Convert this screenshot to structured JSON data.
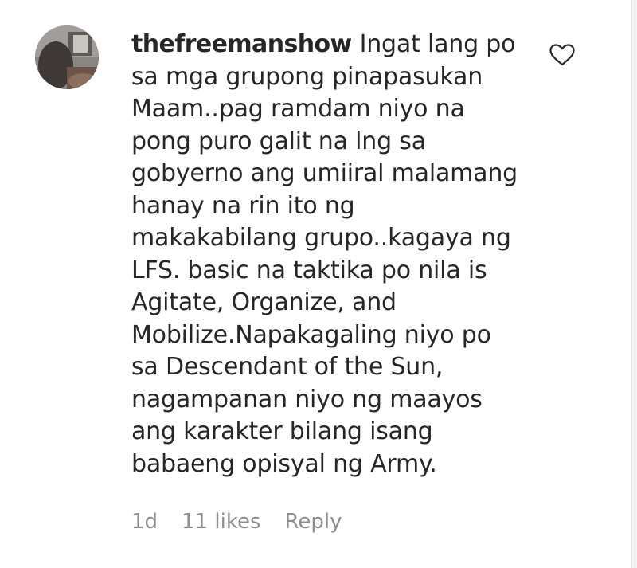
{
  "comment": {
    "username": "thefreemanshow",
    "lines": [
      "Ingat lang po",
      "sa mga grupong pinapasukan",
      "Maam..pag ramdam niyo na",
      "pong puro galit na lng sa",
      "gobyerno ang umiiral malamang",
      "hanay na rin ito ng",
      "makakabilang grupo..kagaya ng",
      "LFS. basic na taktika po nila is",
      "Agitate, Organize, and",
      "Mobilize.Napakagaling niyo po",
      "sa Descendant of the Sun,",
      "nagampanan niyo ng maayos",
      "ang karakter bilang isang",
      "babaeng opisyal ng Army."
    ],
    "time": "1d",
    "likes": "11 likes",
    "reply_label": "Reply",
    "icons": {
      "like": "heart-outline-icon",
      "avatar": "user-avatar"
    },
    "colors": {
      "text": "#262626",
      "meta": "#8e8e8e"
    }
  }
}
